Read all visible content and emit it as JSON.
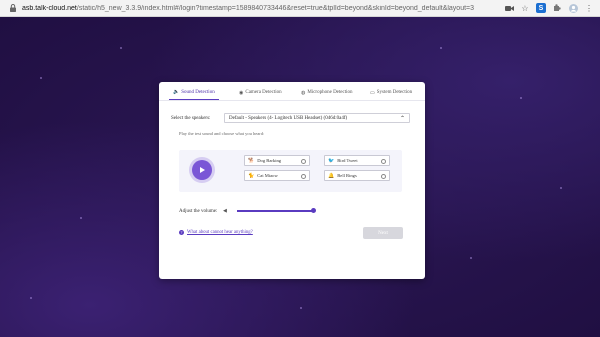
{
  "browser": {
    "url_host": "asb.talk-cloud.net",
    "url_path": "/static/h5_new_3.3.9/index.html#/login?timestamp=1589840733446&reset=true&tplId=beyond&skinId=beyond_default&layout=3",
    "ext_label": "S"
  },
  "tabs": [
    {
      "label": "Sound Detection",
      "icon": "speaker-icon"
    },
    {
      "label": "Camera Detection",
      "icon": "camera-icon"
    },
    {
      "label": "Microphone Detection",
      "icon": "microphone-icon"
    },
    {
      "label": "System Detection",
      "icon": "monitor-icon"
    }
  ],
  "speaker": {
    "label": "Select the speakers:",
    "value": "Default - Speakers (4- Logitech USB Headset) (046d:0a4f)"
  },
  "hint": "Play the test sound and choose what you heard:",
  "options": [
    {
      "label": "Dog Barking",
      "icon": "dog-icon"
    },
    {
      "label": "Bird Tweet",
      "icon": "bird-icon"
    },
    {
      "label": "Cat Miaow",
      "icon": "cat-icon"
    },
    {
      "label": "Bell Rings",
      "icon": "bell-icon"
    }
  ],
  "volume": {
    "label": "Adjust the volume:",
    "level": 1.0
  },
  "help_text": "What about cannot hear anything?",
  "next_label": "Next",
  "colors": {
    "accent": "#5a3bc0",
    "background": "#2a1650",
    "disabled": "#d7d7dd"
  }
}
